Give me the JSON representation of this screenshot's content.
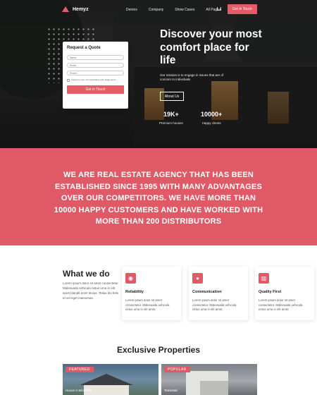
{
  "nav": {
    "logo_text": "Hemyz",
    "items": [
      "Demos",
      "Company",
      "Show Cases",
      "All Pages"
    ],
    "cta": "Get in Touch"
  },
  "hero": {
    "headline": "Discover your most comfort place for life",
    "subtext": "Our mission is to engage in issues that are of concern to individuals",
    "button": "About Us",
    "stats": [
      {
        "value": "19K+",
        "label": "Premium houses"
      },
      {
        "value": "10000+",
        "label": "Happy clients"
      }
    ]
  },
  "quote": {
    "title": "Request a Quote",
    "name_placeholder": "Name",
    "email_placeholder": "Email",
    "phone_placeholder": "Phone",
    "consent": "I agree to your communication and usage terms",
    "button": "Get in Touch"
  },
  "banner": {
    "text": "WE ARE REAL ESTATE AGENCY THAT HAS BEEN ESTABLISHED SINCE 1995 WITH MANY ADVANTAGES OVER OUR COMPETITORS. WE HAVE MORE THAN 10000 HAPPY CUSTOMERS AND HAVE WORKED WITH MORE THAN 200 DISTRIBUTORS"
  },
  "what_we_do": {
    "title": "What we do",
    "text": "Lorem ipsum dolor sit amet consectetur. Malesuada vehicula netus urna in elit amet blandit enim lectus. Tellus leo felis et vel eget maecenas.",
    "cards": [
      {
        "icon": "camera-icon",
        "title": "Reliability",
        "text": "Lorem ipsum dolor sit amet consectetur. Malesuada vehicula netus urna in elit amet."
      },
      {
        "icon": "chat-icon",
        "title": "Communication",
        "text": "Lorem ipsum dolor sit amet consectetur. Malesuada vehicula netus urna in elit amet."
      },
      {
        "icon": "chart-icon",
        "title": "Quality First",
        "text": "Lorem ipsum dolor sit amet consectetur. Malesuada vehicula netus urna in elit amet."
      }
    ]
  },
  "exclusive": {
    "title": "Exclusive Properties",
    "properties": [
      {
        "tag": "FEATURED",
        "name": "House in Brickfield"
      },
      {
        "tag": "POPULAR",
        "name": "TetrisHall"
      }
    ]
  },
  "colors": {
    "accent": "#df5a66",
    "dark": "#222222"
  }
}
